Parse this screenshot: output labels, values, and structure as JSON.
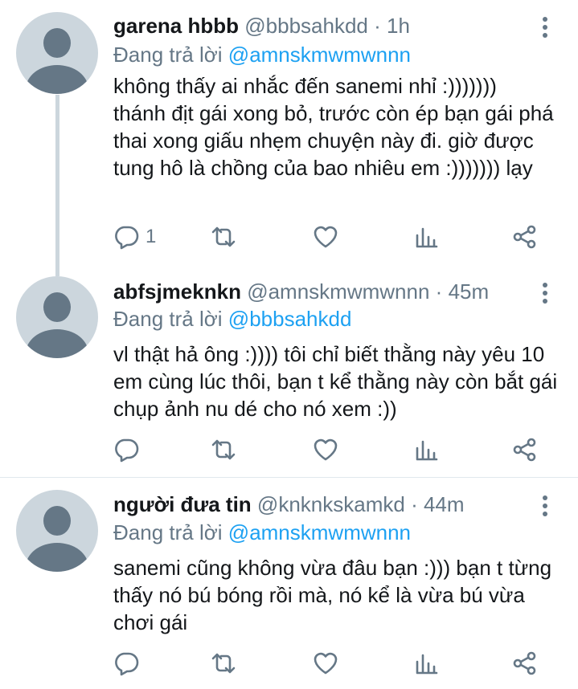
{
  "tweets": [
    {
      "name": "garena hbbb",
      "handle": "@bbbsahkdd",
      "time": "1h",
      "replying_prefix": "Đang trả lời",
      "replying_to": "@amnskmwmwnnn",
      "text": "không thấy ai nhắc đến sanemi nhỉ :)))))))\nthánh địt gái xong bỏ, trước còn ép bạn gái phá thai xong giấu nhẹm chuyện này đi. giờ được tung hô là chồng của bao nhiêu em :))))))) lạy",
      "reply_count": "1"
    },
    {
      "name": "abfsjmeknkn",
      "handle": "@amnskmwmwnnn",
      "time": "45m",
      "replying_prefix": "Đang trả lời",
      "replying_to": "@bbbsahkdd",
      "text": "vl thật hả ông :)))) tôi chỉ biết thằng này yêu 10 em cùng lúc thôi, bạn t kể thằng này còn bắt gái chụp ảnh nu dé cho nó xem :))",
      "reply_count": ""
    },
    {
      "name": "người đưa tin",
      "handle": "@knknkskamkd",
      "time": "44m",
      "replying_prefix": "Đang trả lời",
      "replying_to": "@amnskmwmwnnn",
      "text": "sanemi cũng không vừa đâu bạn :))) bạn t từng thấy nó bú bóng rồi mà, nó kể là vừa bú vừa chơi gái",
      "reply_count": ""
    }
  ],
  "separator": "·",
  "icons": [
    "reply-icon",
    "retweet-icon",
    "like-icon",
    "analytics-icon",
    "share-icon",
    "more-icon"
  ],
  "colors": {
    "link": "#1da1f2",
    "muted": "#657786",
    "text": "#14171a",
    "avatar_bg": "#ccd6dd"
  }
}
